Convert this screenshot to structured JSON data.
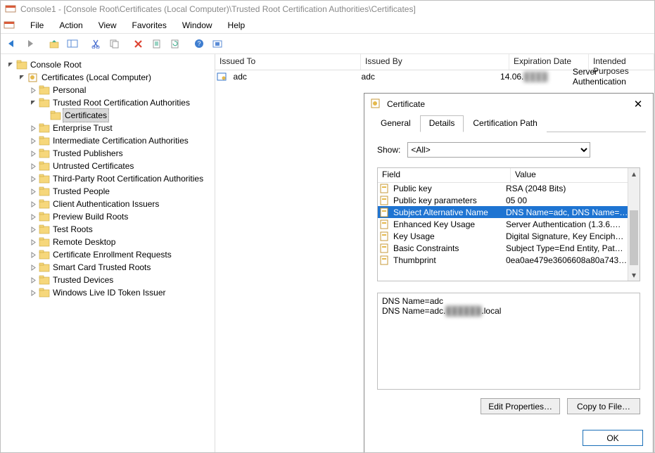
{
  "title": "Console1 - [Console Root\\Certificates (Local Computer)\\Trusted Root Certification Authorities\\Certificates]",
  "menu": {
    "file": "File",
    "action": "Action",
    "view": "View",
    "favorites": "Favorites",
    "window": "Window",
    "help": "Help"
  },
  "tree": {
    "root": "Console Root",
    "certificates": "Certificates (Local Computer)",
    "items": [
      "Personal",
      "Trusted Root Certification Authorities",
      "Certificates",
      "Enterprise Trust",
      "Intermediate Certification Authorities",
      "Trusted Publishers",
      "Untrusted Certificates",
      "Third-Party Root Certification Authorities",
      "Trusted People",
      "Client Authentication Issuers",
      "Preview Build Roots",
      "Test Roots",
      "Remote Desktop",
      "Certificate Enrollment Requests",
      "Smart Card Trusted Roots",
      "Trusted Devices",
      "Windows Live ID Token Issuer"
    ]
  },
  "columns": {
    "issued_to": "Issued To",
    "issued_by": "Issued By",
    "expiration": "Expiration Date",
    "purposes": "Intended Purposes"
  },
  "rows": [
    {
      "issued_to": "adc",
      "issued_by": "adc",
      "expiration": "14.06.",
      "expiration_hidden": "████",
      "purposes": "Server Authentication"
    }
  ],
  "dlg": {
    "title": "Certificate",
    "tabs": {
      "general": "General",
      "details": "Details",
      "certpath": "Certification Path"
    },
    "show_label": "Show:",
    "show_value": "<All>",
    "field_hdr": "Field",
    "value_hdr": "Value",
    "fields": [
      {
        "f": "Public key",
        "v": "RSA (2048 Bits)"
      },
      {
        "f": "Public key parameters",
        "v": "05 00"
      },
      {
        "f": "Subject Alternative Name",
        "v": "DNS Name=adc, DNS Name=a…"
      },
      {
        "f": "Enhanced Key Usage",
        "v": "Server Authentication (1.3.6.…"
      },
      {
        "f": "Key Usage",
        "v": "Digital Signature, Key Encipher…"
      },
      {
        "f": "Basic Constraints",
        "v": "Subject Type=End Entity, Pat…"
      },
      {
        "f": "Thumbprint",
        "v": "0ea0ae479e3606608a80a743…"
      }
    ],
    "selected_index": 2,
    "value_lines": [
      "DNS Name=adc",
      "DNS Name=adc.",
      "██████",
      ".local"
    ],
    "edit_props": "Edit Properties…",
    "copy_to_file": "Copy to File…",
    "ok": "OK"
  }
}
